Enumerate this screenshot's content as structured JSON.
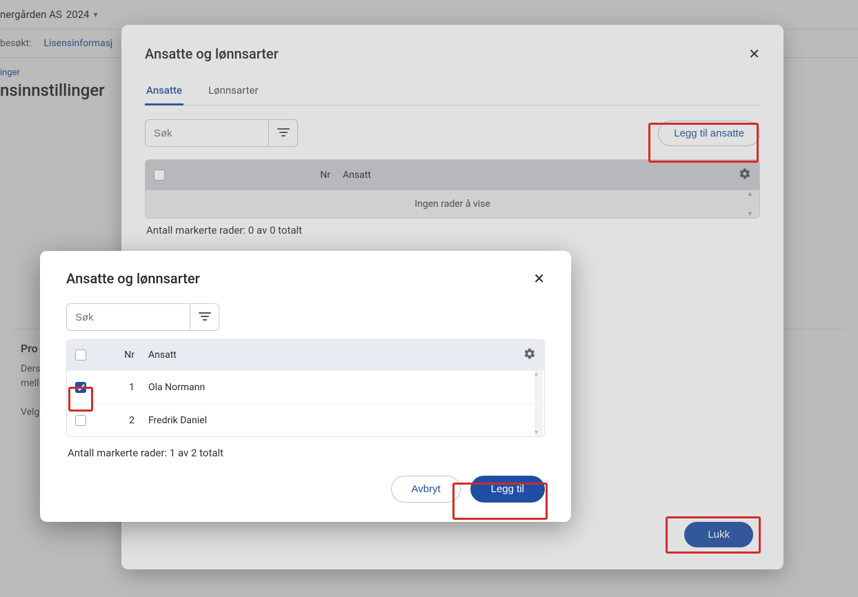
{
  "background": {
    "company": "nergården AS",
    "year": "2024",
    "visited_label": "besøkt:",
    "visited_link": "Lisensinformasj",
    "breadcrumb": "inger",
    "page_title": "nsinnstillinger",
    "section_label": "Pro",
    "body_line1": "Ders",
    "body_line2": "mell",
    "body_line3": "Velg"
  },
  "modal1": {
    "title": "Ansatte og lønnsarter",
    "tabs": {
      "ansatte": "Ansatte",
      "lonnsarter": "Lønnsarter"
    },
    "search_placeholder": "Søk",
    "add_button": "Legg til ansatte",
    "columns": {
      "nr": "Nr",
      "ansatt": "Ansatt"
    },
    "empty": "Ingen rader å vise",
    "count": "Antall markerte rader: 0 av 0 totalt",
    "close_button": "Lukk"
  },
  "modal2": {
    "title": "Ansatte og lønnsarter",
    "search_placeholder": "Søk",
    "columns": {
      "nr": "Nr",
      "ansatt": "Ansatt"
    },
    "rows": [
      {
        "nr": "1",
        "ansatt": "Ola Normann",
        "checked": true
      },
      {
        "nr": "2",
        "ansatt": "Fredrik Daniel",
        "checked": false
      }
    ],
    "count": "Antall markerte rader: 1 av 2 totalt",
    "cancel_button": "Avbryt",
    "add_button": "Legg til"
  }
}
